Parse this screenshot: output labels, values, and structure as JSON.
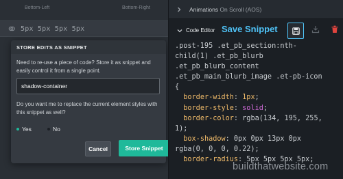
{
  "corner_labels": {
    "bottom_left": "Bottom-Left",
    "bottom_right": "Bottom-Right"
  },
  "radius_value": "5px 5px 5px 5px",
  "popup": {
    "title": "STORE EDITS AS SNIPPET",
    "description": "Need to re-use a piece of code? Store it as snippet and easily control it from a single point.",
    "name_value": "shadow-container",
    "question": "Do you want me to replace the current element styles with this snippet as well?",
    "radio_yes": "Yes",
    "radio_no": "No",
    "selected": "Yes",
    "cancel_label": "Cancel",
    "store_label": "Store Snippet",
    "colors": {
      "accent": "#1fb99a",
      "radio_inactive": "#1b1f24"
    }
  },
  "animations": {
    "title": "Animations",
    "subtitle": "On Scroll (AOS)"
  },
  "editor": {
    "title": "Code Editor",
    "save_snippet_label": "Save Snippet",
    "icons": [
      "save-icon",
      "import-icon",
      "trash-icon"
    ],
    "colors": {
      "highlight": "#4fc3f7",
      "delete": "#e0443e"
    }
  },
  "code": {
    "l1": ".post-195 .et_pb_section:nth-",
    "l2": "child(1) .et_pb_blurb",
    "l3": ".et_pb_blurb_content",
    "l4": ".et_pb_main_blurb_image .et-pb-icon",
    "l5": "{",
    "d1_prop": "border-width",
    "d1_val": "1px",
    "d2_prop": "border-style",
    "d2_val": "solid",
    "d3_prop": "border-color",
    "d3_val": "rgba(134, 195, 255,",
    "d3_cont": "1)",
    "d4_prop": "box-shadow",
    "d4_val": "0px 0px 13px 0px",
    "d4_cont": "rgba(0, 0, 0, 0.22)",
    "d5_prop": "border-radius",
    "d5_val": "5px 5px 5px 5px"
  },
  "watermark": "buildthatwebsite.com"
}
